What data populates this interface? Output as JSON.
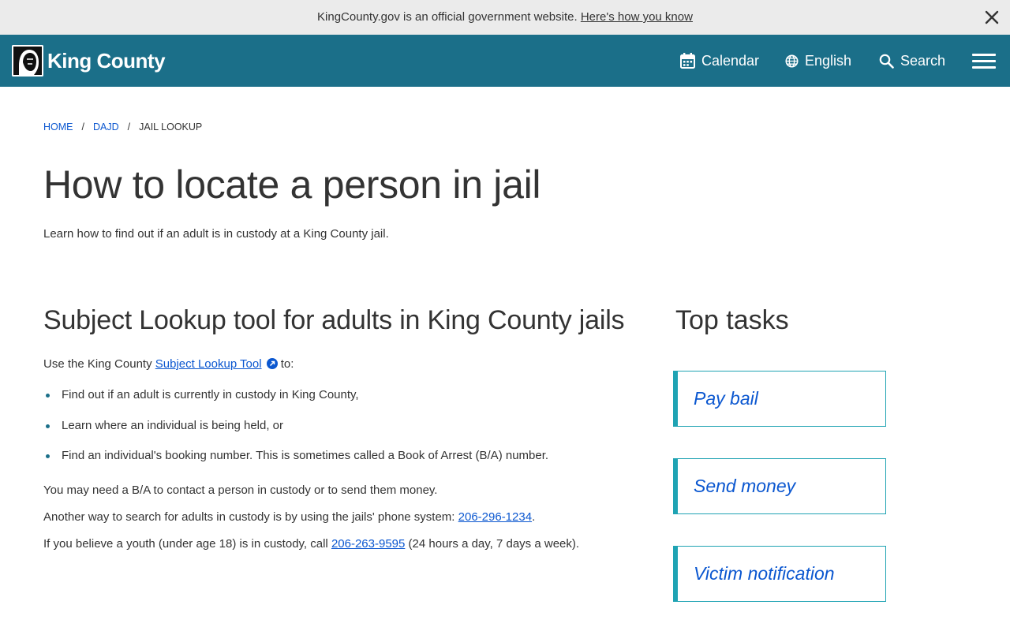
{
  "gov_banner": {
    "text": "KingCounty.gov is an official government website.",
    "link": "Here's how you know"
  },
  "header": {
    "logo_text": "King County",
    "nav": {
      "calendar": "Calendar",
      "language": "English",
      "search": "Search"
    }
  },
  "breadcrumb": {
    "home": "HOME",
    "dajd": "DAJD",
    "current": "JAIL LOOKUP",
    "separator": "/"
  },
  "page": {
    "title": "How to locate a person in jail",
    "intro": "Learn how to find out if an adult is in custody at a King County jail."
  },
  "main": {
    "heading": "Subject Lookup tool for adults in King County jails",
    "lookup_prefix": "Use the King County",
    "lookup_link": "Subject Lookup Tool",
    "lookup_suffix": "to:",
    "bullets": [
      "Find out if an adult is currently in custody in King County,",
      "Learn where an individual is being held, or",
      "Find an individual's booking number. This is sometimes called a Book of Arrest (B/A) number."
    ],
    "para_ba": "You may need a B/A to contact a person in custody or to send them money.",
    "para_phone_prefix": "Another way to search for adults in custody is by using the jails' phone system:",
    "para_phone_number": "206-296-1234",
    "para_phone_suffix": ".",
    "para_youth_prefix": "If you believe a youth (under age 18) is in custody, call",
    "para_youth_number": "206-263-9595",
    "para_youth_suffix": "(24 hours a day, 7 days a week)."
  },
  "sidebar": {
    "heading": "Top tasks",
    "tasks": [
      "Pay bail",
      "Send money",
      "Victim notification"
    ]
  },
  "colors": {
    "header_bg": "#1b6f89",
    "banner_bg": "#ebebeb",
    "link": "#0b57d0",
    "card_accent": "#1fa3b3"
  },
  "icons": {
    "close": "close-icon",
    "calendar": "calendar-icon",
    "language": "globe-icon",
    "search": "search-icon",
    "menu": "hamburger-menu-icon",
    "external": "external-link-icon"
  }
}
